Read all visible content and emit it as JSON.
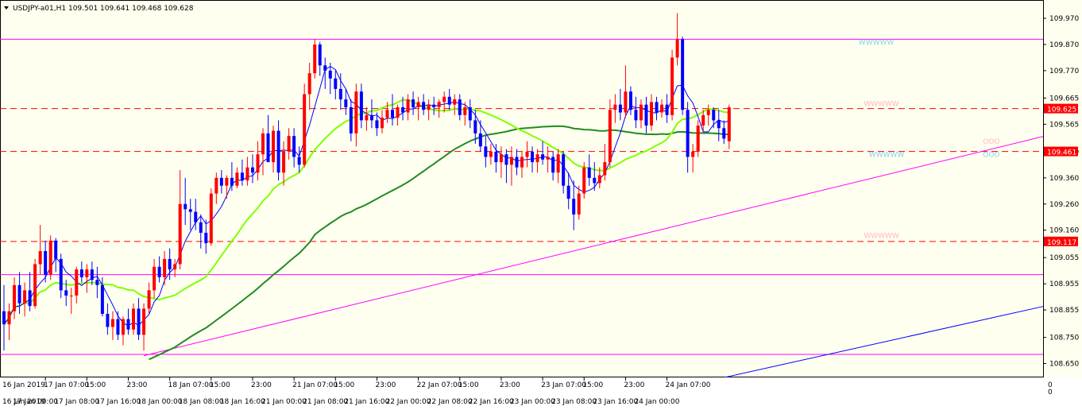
{
  "header": {
    "symbol": "USDJPY-a01,H1",
    "ohlc": "109.501 109.641 109.468 109.628"
  },
  "colors": {
    "background": "#fffff0",
    "bull": "#ff0000",
    "bear": "#0000ff",
    "ma_fast": "#0000ff",
    "ma_mid": "#80ff00",
    "ma_slow": "#228b22",
    "hline_solid": "#ff00ff",
    "hline_dashed": "#ff0000",
    "trendline_magenta": "#ff00ff",
    "trendline_blue": "#0000ff",
    "price_tag": "#ff0000"
  },
  "chart_data": {
    "type": "candlestick",
    "symbol": "USDJPY-a01",
    "timeframe": "H1",
    "ylim": [
      108.6,
      110.04
    ],
    "y_ticks": [
      "109.970",
      "109.870",
      "109.770",
      "109.665",
      "109.565",
      "109.460",
      "109.360",
      "109.260",
      "109.160",
      "109.055",
      "108.955",
      "108.855",
      "108.750",
      "108.650"
    ],
    "x_ticks_row1": [
      "17 Jan 07:00",
      "15:00",
      "23:00",
      "18 Jan 07:00",
      "15:00",
      "23:00",
      "21 Jan 07:00",
      "15:00",
      "23:00",
      "22 Jan 07:00",
      "15:00",
      "23:00",
      "23 Jan 07:00",
      "15:00",
      "23:00",
      "24 Jan 07:00"
    ],
    "x_ticks_row2": [
      "17 Jan 00:00",
      "17 Jan 08:00",
      "17 Jan 16:00",
      "18 Jan 00:00",
      "18 Jan 08:00",
      "18 Jan 16:00",
      "21 Jan 00:00",
      "21 Jan 08:00",
      "21 Jan 16:00",
      "22 Jan 00:00",
      "22 Jan 08:00",
      "22 Jan 16:00",
      "23 Jan 00:00",
      "23 Jan 08:00",
      "23 Jan 16:00",
      "24 Jan 00:00"
    ],
    "first_date_row1": "16 Jan 2019",
    "first_date_row2": "16 Jan 2019",
    "axis_zero_label_1": "0",
    "axis_zero_label_2": "0",
    "horizontal_levels": [
      {
        "value": 109.89,
        "style": "solid",
        "color": "#ff00ff"
      },
      {
        "value": 109.625,
        "style": "dashed",
        "color": "#ff0000",
        "tag": "109.625"
      },
      {
        "value": 109.461,
        "style": "dashed",
        "color": "#ff0000",
        "tag": "109.461"
      },
      {
        "value": 109.117,
        "style": "dashed",
        "color": "#ff0000",
        "tag": "109.117"
      },
      {
        "value": 108.99,
        "style": "solid",
        "color": "#ff00ff"
      },
      {
        "value": 108.685,
        "style": "solid",
        "color": "#ff00ff"
      }
    ],
    "trendlines": [
      {
        "color": "#ff00ff",
        "from": [
          27,
          108.68
        ],
        "to": [
          201,
          109.52
        ]
      },
      {
        "color": "#0000ff",
        "from": [
          133,
          108.57
        ],
        "to": [
          201,
          108.87
        ]
      }
    ],
    "annotations": [
      {
        "text": "WWWWW",
        "color": "#87ceeb",
        "bar": 165,
        "value": 109.87
      },
      {
        "text": "WWWWW",
        "color": "#ffb6c1",
        "bar": 166,
        "value": 109.635
      },
      {
        "text": "WWWWW",
        "color": "#87ceeb",
        "bar": 167,
        "value": 109.44
      },
      {
        "text": "WWWWW",
        "color": "#ffb6c1",
        "bar": 166,
        "value": 109.13
      },
      {
        "text": "OOO",
        "color": "#ffb6c1",
        "bar": 189,
        "value": 109.49
      },
      {
        "text": "OOO",
        "color": "#87ceeb",
        "bar": 189,
        "value": 109.44
      }
    ],
    "candles": [
      [
        108.85,
        108.95,
        108.7,
        108.8
      ],
      [
        108.8,
        108.88,
        108.74,
        108.85
      ],
      [
        108.85,
        108.98,
        108.82,
        108.95
      ],
      [
        108.95,
        109.0,
        108.84,
        108.88
      ],
      [
        108.88,
        108.96,
        108.83,
        108.93
      ],
      [
        108.93,
        109.0,
        108.85,
        108.87
      ],
      [
        108.87,
        109.05,
        108.86,
        109.03
      ],
      [
        109.03,
        109.18,
        108.99,
        109.08
      ],
      [
        109.08,
        109.12,
        108.96,
        108.99
      ],
      [
        108.99,
        109.14,
        108.97,
        109.12
      ],
      [
        109.12,
        109.13,
        109.0,
        109.05
      ],
      [
        109.05,
        109.07,
        108.9,
        108.93
      ],
      [
        108.93,
        108.97,
        108.87,
        108.91
      ],
      [
        108.91,
        108.94,
        108.84,
        108.91
      ],
      [
        108.91,
        109.02,
        108.88,
        109.01
      ],
      [
        109.01,
        109.04,
        108.96,
        108.98
      ],
      [
        108.98,
        109.03,
        108.92,
        109.01
      ],
      [
        109.01,
        109.04,
        108.95,
        108.97
      ],
      [
        108.97,
        109.02,
        108.9,
        108.95
      ],
      [
        108.95,
        108.98,
        108.83,
        108.84
      ],
      [
        108.84,
        108.88,
        108.76,
        108.79
      ],
      [
        108.79,
        108.85,
        108.74,
        108.82
      ],
      [
        108.82,
        108.85,
        108.74,
        108.76
      ],
      [
        108.76,
        108.83,
        108.72,
        108.82
      ],
      [
        108.82,
        108.86,
        108.76,
        108.78
      ],
      [
        108.78,
        108.88,
        108.76,
        108.86
      ],
      [
        108.86,
        108.9,
        108.74,
        108.76
      ],
      [
        108.76,
        108.88,
        108.7,
        108.86
      ],
      [
        108.86,
        108.96,
        108.84,
        108.93
      ],
      [
        108.93,
        109.05,
        108.9,
        109.02
      ],
      [
        109.02,
        109.06,
        108.96,
        108.98
      ],
      [
        108.98,
        109.08,
        108.95,
        109.05
      ],
      [
        109.05,
        109.09,
        108.97,
        109.01
      ],
      [
        109.01,
        109.05,
        108.98,
        109.03
      ],
      [
        109.03,
        109.39,
        109.01,
        109.26
      ],
      [
        109.26,
        109.36,
        109.18,
        109.24
      ],
      [
        109.24,
        109.28,
        109.16,
        109.23
      ],
      [
        109.23,
        109.28,
        109.16,
        109.19
      ],
      [
        109.19,
        109.22,
        109.09,
        109.15
      ],
      [
        109.15,
        109.2,
        109.07,
        109.11
      ],
      [
        109.11,
        109.32,
        109.1,
        109.3
      ],
      [
        109.3,
        109.38,
        109.26,
        109.36
      ],
      [
        109.36,
        109.39,
        109.3,
        109.33
      ],
      [
        109.33,
        109.37,
        109.28,
        109.36
      ],
      [
        109.36,
        109.42,
        109.31,
        109.33
      ],
      [
        109.33,
        109.4,
        109.32,
        109.38
      ],
      [
        109.38,
        109.43,
        109.33,
        109.35
      ],
      [
        109.35,
        109.44,
        109.33,
        109.4
      ],
      [
        109.4,
        109.45,
        109.34,
        109.38
      ],
      [
        109.38,
        109.5,
        109.35,
        109.45
      ],
      [
        109.45,
        109.55,
        109.37,
        109.53
      ],
      [
        109.53,
        109.6,
        109.48,
        109.42
      ],
      [
        109.42,
        109.56,
        109.38,
        109.54
      ],
      [
        109.54,
        109.58,
        109.35,
        109.38
      ],
      [
        109.38,
        109.5,
        109.33,
        109.46
      ],
      [
        109.46,
        109.55,
        109.43,
        109.52
      ],
      [
        109.52,
        109.55,
        109.4,
        109.44
      ],
      [
        109.44,
        109.48,
        109.38,
        109.41
      ],
      [
        109.41,
        109.72,
        109.4,
        109.68
      ],
      [
        109.68,
        109.8,
        109.62,
        109.76
      ],
      [
        109.76,
        109.89,
        109.74,
        109.87
      ],
      [
        109.87,
        109.88,
        109.75,
        109.79
      ],
      [
        109.79,
        109.82,
        109.7,
        109.77
      ],
      [
        109.77,
        109.8,
        109.68,
        109.74
      ],
      [
        109.74,
        109.77,
        109.66,
        109.7
      ],
      [
        109.7,
        109.76,
        109.62,
        109.66
      ],
      [
        109.66,
        109.7,
        109.6,
        109.63
      ],
      [
        109.63,
        109.66,
        109.5,
        109.53
      ],
      [
        109.53,
        109.72,
        109.48,
        109.69
      ],
      [
        109.69,
        109.72,
        109.55,
        109.58
      ],
      [
        109.58,
        109.63,
        109.54,
        109.6
      ],
      [
        109.6,
        109.66,
        109.55,
        109.58
      ],
      [
        109.58,
        109.61,
        109.52,
        109.55
      ],
      [
        109.55,
        109.62,
        109.53,
        109.59
      ],
      [
        109.59,
        109.65,
        109.57,
        109.62
      ],
      [
        109.62,
        109.68,
        109.56,
        109.59
      ],
      [
        109.59,
        109.64,
        109.56,
        109.63
      ],
      [
        109.63,
        109.67,
        109.58,
        109.61
      ],
      [
        109.61,
        109.68,
        109.58,
        109.66
      ],
      [
        109.66,
        109.69,
        109.6,
        109.63
      ],
      [
        109.63,
        109.67,
        109.58,
        109.65
      ],
      [
        109.65,
        109.68,
        109.6,
        109.62
      ],
      [
        109.62,
        109.66,
        109.58,
        109.64
      ],
      [
        109.64,
        109.67,
        109.6,
        109.63
      ],
      [
        109.63,
        109.66,
        109.59,
        109.65
      ],
      [
        109.65,
        109.69,
        109.61,
        109.67
      ],
      [
        109.67,
        109.7,
        109.62,
        109.64
      ],
      [
        109.64,
        109.68,
        109.6,
        109.66
      ],
      [
        109.66,
        109.68,
        109.58,
        109.6
      ],
      [
        109.6,
        109.65,
        109.56,
        109.63
      ],
      [
        109.63,
        109.66,
        109.55,
        109.58
      ],
      [
        109.58,
        109.62,
        109.49,
        109.53
      ],
      [
        109.53,
        109.58,
        109.46,
        109.48
      ],
      [
        109.48,
        109.52,
        109.4,
        109.44
      ],
      [
        109.44,
        109.49,
        109.41,
        109.46
      ],
      [
        109.46,
        109.49,
        109.38,
        109.42
      ],
      [
        109.42,
        109.48,
        109.36,
        109.45
      ],
      [
        109.45,
        109.47,
        109.34,
        109.41
      ],
      [
        109.41,
        109.48,
        109.33,
        109.44
      ],
      [
        109.44,
        109.47,
        109.37,
        109.4
      ],
      [
        109.4,
        109.46,
        109.36,
        109.44
      ],
      [
        109.44,
        109.5,
        109.4,
        109.46
      ],
      [
        109.46,
        109.48,
        109.38,
        109.42
      ],
      [
        109.42,
        109.47,
        109.38,
        109.45
      ],
      [
        109.45,
        109.5,
        109.41,
        109.43
      ],
      [
        109.43,
        109.48,
        109.38,
        109.44
      ],
      [
        109.44,
        109.46,
        109.35,
        109.38
      ],
      [
        109.38,
        109.47,
        109.34,
        109.45
      ],
      [
        109.45,
        109.46,
        109.3,
        109.33
      ],
      [
        109.33,
        109.38,
        109.24,
        109.28
      ],
      [
        109.28,
        109.35,
        109.16,
        109.22
      ],
      [
        109.22,
        109.33,
        109.2,
        109.3
      ],
      [
        109.3,
        109.42,
        109.28,
        109.4
      ],
      [
        109.4,
        109.45,
        109.33,
        109.36
      ],
      [
        109.36,
        109.42,
        109.31,
        109.34
      ],
      [
        109.34,
        109.4,
        109.32,
        109.37
      ],
      [
        109.37,
        109.49,
        109.35,
        109.42
      ],
      [
        109.42,
        109.66,
        109.4,
        109.62
      ],
      [
        109.62,
        109.68,
        109.57,
        109.64
      ],
      [
        109.64,
        109.7,
        109.58,
        109.61
      ],
      [
        109.61,
        109.79,
        109.59,
        109.69
      ],
      [
        109.69,
        109.71,
        109.6,
        109.62
      ],
      [
        109.62,
        109.67,
        109.55,
        109.58
      ],
      [
        109.58,
        109.66,
        109.55,
        109.64
      ],
      [
        109.64,
        109.67,
        109.53,
        109.56
      ],
      [
        109.56,
        109.68,
        109.54,
        109.65
      ],
      [
        109.65,
        109.67,
        109.58,
        109.61
      ],
      [
        109.61,
        109.66,
        109.59,
        109.64
      ],
      [
        109.64,
        109.68,
        109.57,
        109.6
      ],
      [
        109.6,
        109.85,
        109.58,
        109.82
      ],
      [
        109.82,
        109.99,
        109.79,
        109.89
      ],
      [
        109.89,
        109.9,
        109.6,
        109.62
      ],
      [
        109.62,
        109.65,
        109.38,
        109.44
      ],
      [
        109.44,
        109.49,
        109.38,
        109.46
      ],
      [
        109.46,
        109.58,
        109.44,
        109.56
      ],
      [
        109.56,
        109.62,
        109.54,
        109.6
      ],
      [
        109.6,
        109.64,
        109.56,
        109.62
      ],
      [
        109.62,
        109.63,
        109.55,
        109.58
      ],
      [
        109.58,
        109.62,
        109.5,
        109.55
      ],
      [
        109.55,
        109.58,
        109.49,
        109.51
      ],
      [
        109.5,
        109.64,
        109.47,
        109.63
      ]
    ]
  }
}
